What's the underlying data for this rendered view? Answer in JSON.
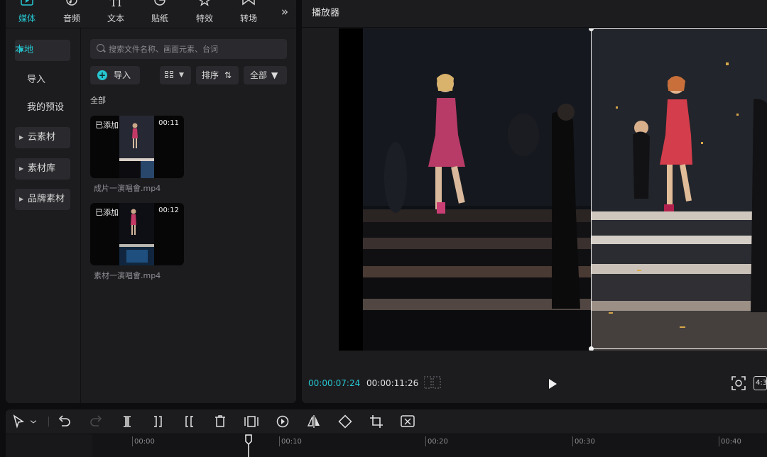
{
  "media_tabs": [
    {
      "label": "媒体",
      "icon": "media-icon",
      "active": true
    },
    {
      "label": "音频",
      "icon": "audio-icon"
    },
    {
      "label": "文本",
      "icon": "text-icon"
    },
    {
      "label": "贴纸",
      "icon": "sticker-icon"
    },
    {
      "label": "特效",
      "icon": "effects-icon"
    },
    {
      "label": "转场",
      "icon": "transition-icon"
    }
  ],
  "left_nav": {
    "local": "本地",
    "import": "导入",
    "presets": "我的预设",
    "cloud": "云素材",
    "library": "素材库",
    "brand": "品牌素材"
  },
  "search": {
    "placeholder": "搜索文件名称、画面元素、台词"
  },
  "toolbar_buttons": {
    "import": "导入",
    "sort": "排序",
    "all": "全部"
  },
  "section_label": "全部",
  "clips": [
    {
      "badge": "已添加",
      "duration": "00:11",
      "name": "成片一演唱會.mp4"
    },
    {
      "badge": "已添加",
      "duration": "00:12",
      "name": "素材一演唱會.mp4"
    }
  ],
  "player": {
    "title": "播放器",
    "current_time": "00:00:07:24",
    "total_time": "00:00:11:26",
    "ratio": "4:3"
  },
  "timeline": {
    "ticks": [
      "00:00",
      "00:10",
      "00:20",
      "00:30",
      "00:40"
    ]
  },
  "colors": {
    "accent": "#26c6d0",
    "panel": "#1c1c1f",
    "background": "#0d0d0f"
  }
}
